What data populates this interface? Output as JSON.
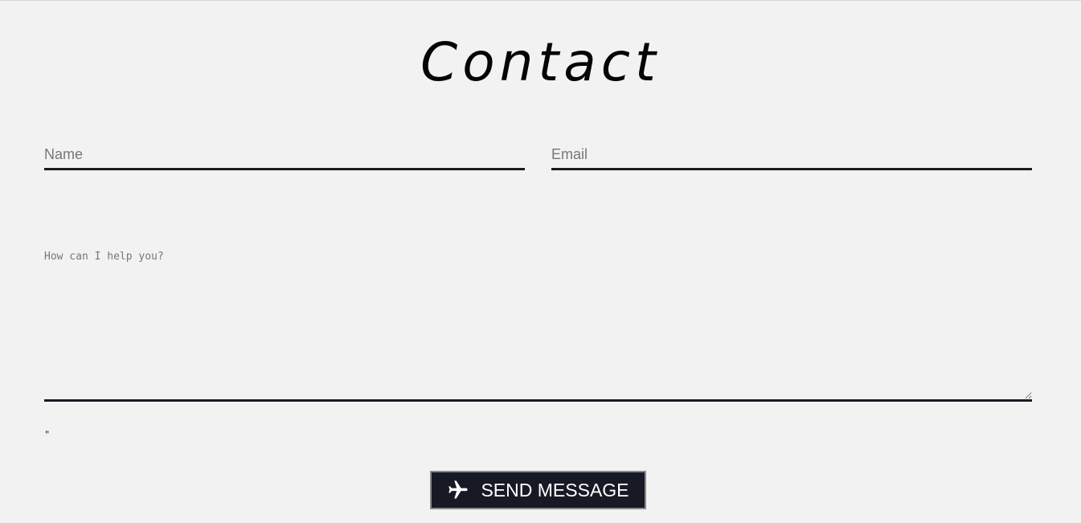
{
  "page": {
    "title": "Contact"
  },
  "form": {
    "name_placeholder": "Name",
    "email_placeholder": "Email",
    "message_placeholder": "How can I help you?",
    "stray_text": "\"",
    "send_label": "SEND MESSAGE",
    "send_icon": "plane-icon"
  },
  "colors": {
    "background": "#f2f2f2",
    "underline": "#1a1a24",
    "button_bg": "#171a24",
    "button_text": "#ffffff"
  }
}
